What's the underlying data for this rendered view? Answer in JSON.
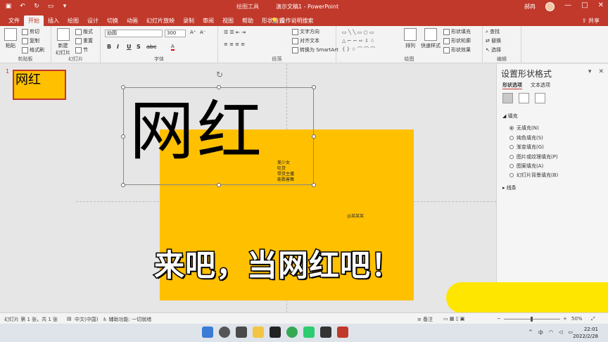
{
  "titlebar": {
    "context_label": "绘图工具",
    "doc_title": "演示文稿1 - PowerPoint",
    "user": "郝冉",
    "controls": [
      "—",
      "□",
      "✕"
    ]
  },
  "tabs": [
    "文件",
    "开始",
    "插入",
    "绘图",
    "设计",
    "切换",
    "动画",
    "幻灯片放映",
    "录制",
    "审阅",
    "视图",
    "帮助",
    "形状格式"
  ],
  "tellme": "操作说明搜索",
  "share": "共享",
  "ribbon": {
    "clipboard": {
      "paste": "粘贴",
      "cut": "剪切",
      "copy": "复制",
      "format_painter": "格式刷",
      "label": "剪贴板"
    },
    "slides": {
      "new_slide": "新建\n幻灯片",
      "layout": "版式",
      "reset": "重置",
      "section": "节",
      "label": "幻灯片"
    },
    "font": {
      "font_name": "幼圆",
      "font_size": "300",
      "bold": "B",
      "italic": "I",
      "underline": "U",
      "shadow": "S",
      "strike": "abc",
      "label": "字体"
    },
    "paragraph": {
      "text_direction": "文字方向",
      "align_text": "对齐文本",
      "smartart": "转换为 SmartArt",
      "label": "段落"
    },
    "drawing": {
      "arrange": "排列",
      "quick_styles": "快速样式",
      "shape_fill": "形状填充",
      "shape_outline": "形状轮廓",
      "shape_effects": "形状效果",
      "label": "绘图"
    },
    "editing": {
      "find": "查找",
      "replace": "替换",
      "select": "选择",
      "label": "编辑"
    }
  },
  "thumbnail": {
    "number": "1",
    "text": "网红"
  },
  "slide": {
    "big_text": "网红",
    "notes": [
      "美少女",
      "吃货",
      "带货主播",
      "能歌善舞"
    ],
    "credit": "@某某某",
    "subtitle": "来吧，当网红吧！"
  },
  "format_pane": {
    "title": "设置形状格式",
    "tabs": [
      "形状选项",
      "文本选项"
    ],
    "fill_section": "填充",
    "fill_options": [
      "无填充(N)",
      "纯色填充(S)",
      "渐变填充(G)",
      "图片或纹理填充(P)",
      "图案填充(A)",
      "幻灯片背景填充(B)"
    ],
    "line_section": "线条"
  },
  "statusbar": {
    "slide_info": "幻灯片 第 1 张，共 1 张",
    "language": "中文(中国)",
    "accessibility": "辅助功能: 一切就绪",
    "notes": "备注",
    "zoom": "50%"
  },
  "taskbar": {
    "lang": "中",
    "time": "22:01",
    "date": "2022/2/28"
  },
  "colors": {
    "accent": "#c0392b",
    "slide_yellow": "#ffc000"
  }
}
